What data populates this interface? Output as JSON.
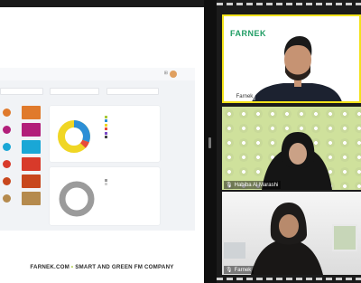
{
  "shared_screen": {
    "dashboard": {
      "filter_labels": [
        "—",
        "—",
        "—"
      ],
      "tiles": [
        {
          "label": "",
          "color": "#e07a2c",
          "icon_color": "#e07a2c",
          "icon": "circle-icon"
        },
        {
          "label": "",
          "color": "#b21f7a",
          "icon_color": "#b21f7a",
          "icon": "building-icon"
        },
        {
          "label": "",
          "color": "#1aa7d6",
          "icon_color": "#1aa7d6",
          "icon": "circle-icon"
        },
        {
          "label": "",
          "color": "#d83a2a",
          "icon_color": "#d83a2a",
          "icon": "alert-icon"
        },
        {
          "label": "",
          "color": "#c8471d",
          "icon_color": "#c8471d",
          "icon": "flame-icon"
        },
        {
          "label": "",
          "color": "#b58a4d",
          "icon_color": "#b58a4d",
          "icon": "document-icon"
        }
      ],
      "donut_card": {
        "title": "",
        "legend": [
          "",
          "",
          "",
          "",
          "",
          ""
        ],
        "segments": [
          {
            "value": 55,
            "color": "#f0d624"
          },
          {
            "value": 40,
            "color": "#2d8fd6"
          },
          {
            "value": 5,
            "color": "#e84a3a"
          }
        ],
        "center_text": ""
      },
      "ring_card": {
        "title": "",
        "legend": [
          "",
          ""
        ],
        "center_text": "",
        "color": "#9b9b9b"
      }
    },
    "footer": {
      "left": "FARNEK.COM",
      "separator": "•",
      "right": "SMART AND GREEN FM COMPANY"
    }
  },
  "participants": [
    {
      "name": "Farnek",
      "logo": "FARNEK",
      "logo_sub": "",
      "active_speaker": true
    },
    {
      "name": "Habiba Al Marashi",
      "active_speaker": false
    },
    {
      "name": "Farnek",
      "active_speaker": false
    }
  ],
  "colors": {
    "brand_green": "#1e9c63",
    "accent_lime": "#a9c93a",
    "active_speaker_border": "#f2e21b"
  }
}
